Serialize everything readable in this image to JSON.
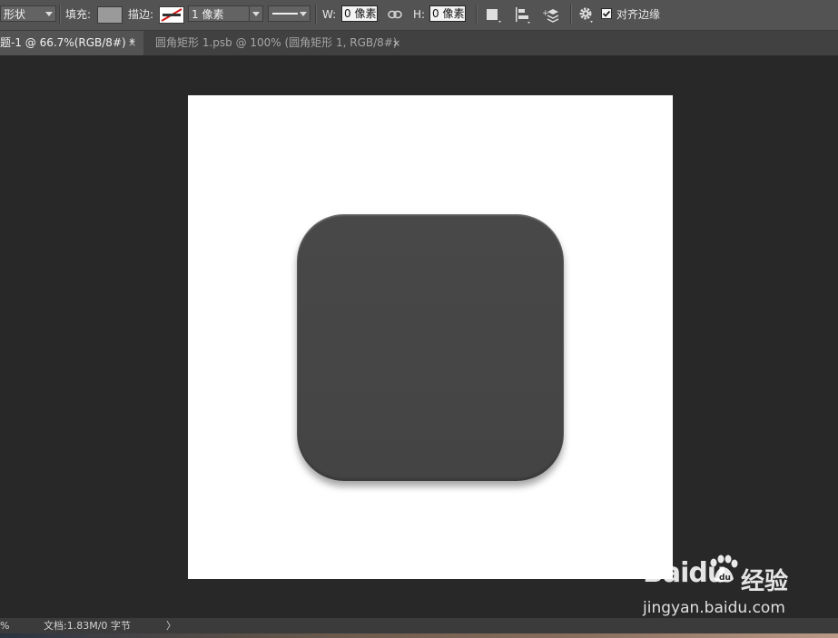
{
  "options_bar": {
    "mode_value": "形状",
    "fill_label": "填充:",
    "stroke_label": "描边:",
    "stroke_width_value": "1 像素",
    "w_label": "W:",
    "w_value": "0 像素",
    "h_label": "H:",
    "h_value": "0 像素",
    "align_edges_label": "对齐边缘",
    "align_edges_checked": true,
    "fill_color": "#9a9a9a"
  },
  "tabs": [
    {
      "label": "题-1 @ 66.7%(RGB/8#) *",
      "close": "×",
      "active": true
    },
    {
      "label": "圆角矩形 1.psb @ 100% (圆角矩形 1, RGB/8#)",
      "close": "×",
      "active": false
    }
  ],
  "canvas": {
    "background": "#ffffff",
    "shape_color": "#464646"
  },
  "status_bar": {
    "zoom_fragment": "%",
    "doc_info": "文档:1.83M/0 字节",
    "arrow": "〉"
  },
  "watermark": {
    "brand": "Baidu",
    "product": "经验",
    "url": "jingyan.baidu.com"
  },
  "icons": [
    "dropdown-arrow-icon",
    "link-chain-icon",
    "path-operations-icon",
    "path-alignment-icon",
    "path-arrangement-icon",
    "gear-icon",
    "checkbox-icon",
    "close-icon",
    "baidu-paw-icon"
  ]
}
